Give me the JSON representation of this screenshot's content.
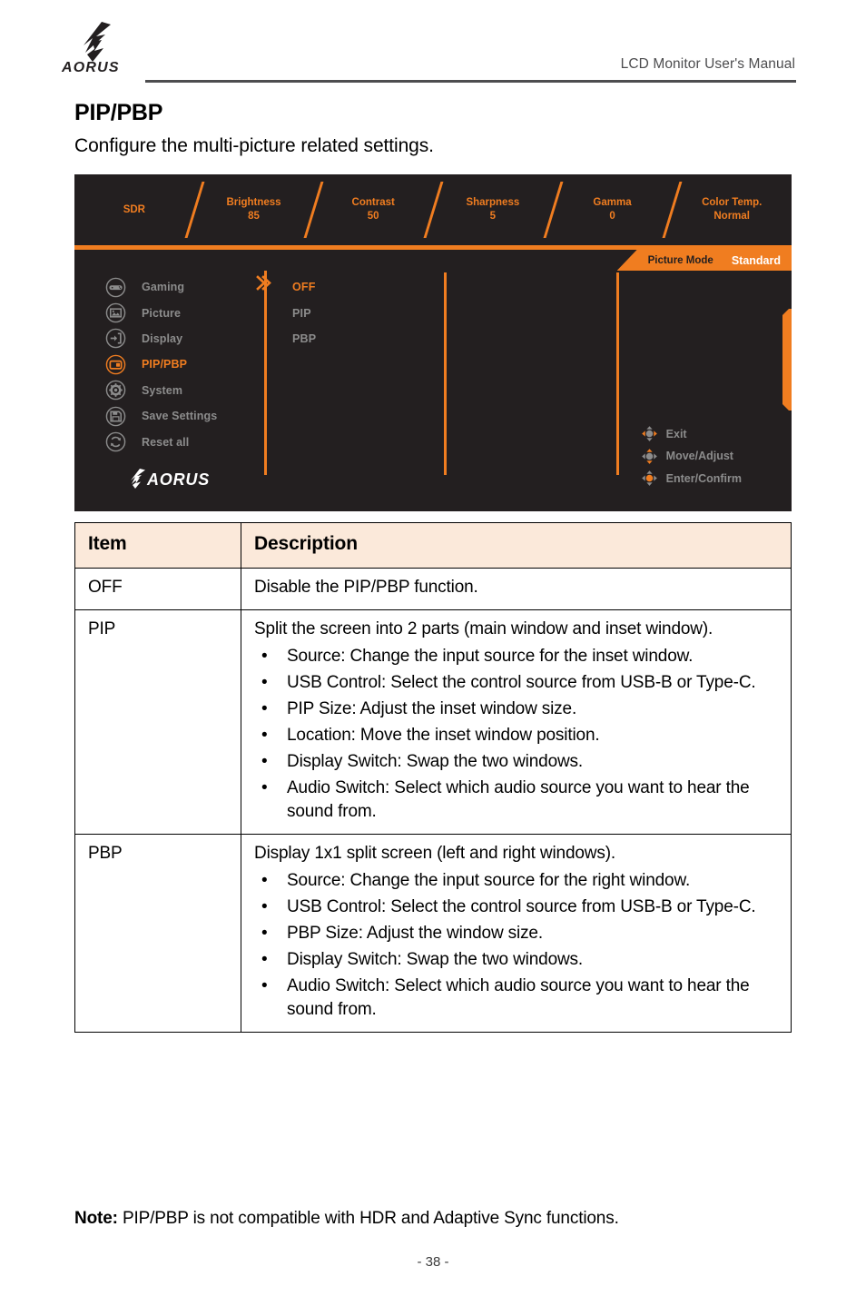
{
  "header": {
    "title": "LCD Monitor User's Manual",
    "logo_text": "AORUS"
  },
  "section": {
    "title": "PIP/PBP",
    "intro": "Configure the multi-picture related settings."
  },
  "osd": {
    "topbar": [
      {
        "label": "SDR",
        "value": ""
      },
      {
        "label": "Brightness",
        "value": "85"
      },
      {
        "label": "Contrast",
        "value": "50"
      },
      {
        "label": "Sharpness",
        "value": "5"
      },
      {
        "label": "Gamma",
        "value": "0"
      },
      {
        "label": "Color Temp.",
        "value": "Normal"
      }
    ],
    "picture_mode": {
      "label": "Picture Mode",
      "value": "Standard"
    },
    "menu": [
      {
        "label": "Gaming",
        "icon": "gamepad-icon",
        "active": false
      },
      {
        "label": "Picture",
        "icon": "image-icon",
        "active": false
      },
      {
        "label": "Display",
        "icon": "input-arrow-icon",
        "active": false
      },
      {
        "label": "PIP/PBP",
        "icon": "pip-window-icon",
        "active": true
      },
      {
        "label": "System",
        "icon": "gear-icon",
        "active": false
      },
      {
        "label": "Save Settings",
        "icon": "floppy-disk-icon",
        "active": false
      },
      {
        "label": "Reset all",
        "icon": "reset-arrows-icon",
        "active": false
      }
    ],
    "submenu": [
      {
        "label": "OFF",
        "active": true
      },
      {
        "label": "PIP",
        "active": false
      },
      {
        "label": "PBP",
        "active": false
      }
    ],
    "nav_hints": [
      {
        "label": "Exit",
        "icon": "dpad-left-icon"
      },
      {
        "label": "Move/Adjust",
        "icon": "dpad-up-icon"
      },
      {
        "label": "Enter/Confirm",
        "icon": "dpad-center-icon"
      }
    ],
    "logo_text": "AORUS",
    "colors": {
      "accent": "#f07d20",
      "panel_bg": "#231f20",
      "inactive_text": "#8c8c8c"
    }
  },
  "table": {
    "headers": [
      "Item",
      "Description"
    ],
    "rows": [
      {
        "item": "OFF",
        "lead": "Disable the PIP/PBP function.",
        "bullets": []
      },
      {
        "item": "PIP",
        "lead": "Split the screen into 2 parts (main window and inset window).",
        "bullets": [
          "Source:  Change the input source for the inset window.",
          "USB Control: Select the control source from USB-B or Type-C.",
          "PIP Size: Adjust the inset window size.",
          "Location:  Move the inset window position.",
          "Display Switch: Swap the two windows.",
          "Audio Switch: Select which audio source you want to hear the sound from."
        ]
      },
      {
        "item": "PBP",
        "lead": "Display 1x1 split screen (left and right windows).",
        "bullets": [
          "Source: Change the input source for the right window.",
          "USB Control: Select the control source from USB-B or Type-C.",
          "PBP Size: Adjust the window size.",
          "Display Switch: Swap the two windows.",
          "Audio Switch: Select which audio source you want to hear the sound from."
        ]
      }
    ]
  },
  "note": {
    "prefix": "Note:",
    "text": " PIP/PBP is not compatible with HDR and Adaptive Sync functions."
  },
  "footer": {
    "page_number": "- 38 -"
  }
}
